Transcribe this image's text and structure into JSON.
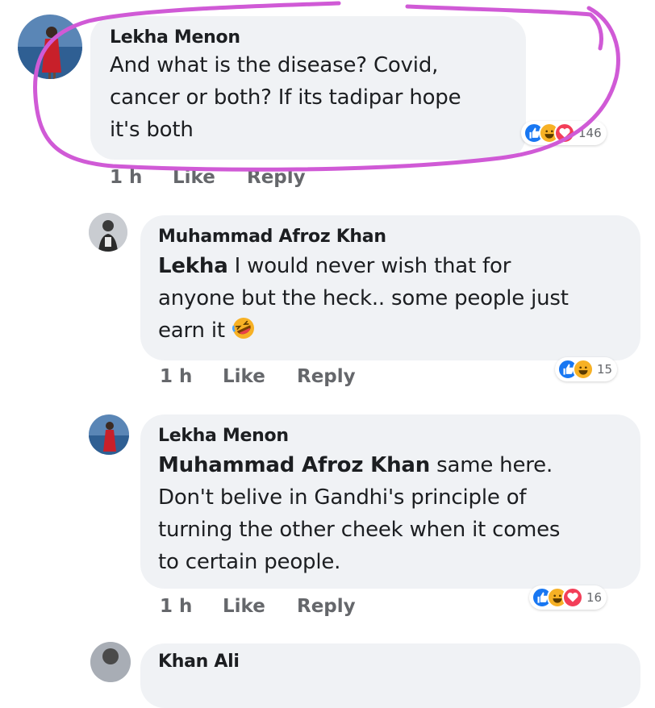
{
  "comments": [
    {
      "author": "Lekha Menon",
      "text": "And what is the disease? Covid, cancer or both? If its tadipar hope it's both",
      "text_lines": [
        "And what is the disease? Covid,",
        "cancer or both? If its tadipar hope",
        "it's both"
      ],
      "time": "1 h",
      "like_label": "Like",
      "reply_label": "Reply",
      "reaction_count": "146",
      "reactions": [
        "like-icon",
        "haha-icon",
        "love-icon"
      ]
    },
    {
      "author": "Muhammad Afroz Khan",
      "mention": "Lekha",
      "text_lines": [
        " I would never wish that for",
        "anyone but the heck.. some people just",
        "earn it "
      ],
      "emoji": "rolling-on-floor-laughing-icon",
      "time": "1 h",
      "like_label": "Like",
      "reply_label": "Reply",
      "reaction_count": "15",
      "reactions": [
        "like-icon",
        "haha-icon"
      ]
    },
    {
      "author": "Lekha Menon",
      "mention": "Muhammad Afroz Khan",
      "text_lines": [
        " same here.",
        "Don't belive in Gandhi's principle of",
        "turning the other cheek when it comes",
        "to certain people."
      ],
      "time": "1 h",
      "like_label": "Like",
      "reply_label": "Reply",
      "reaction_count": "16",
      "reactions": [
        "like-icon",
        "haha-icon",
        "love-icon"
      ]
    },
    {
      "author": "Khan Ali"
    }
  ],
  "colors": {
    "like": "#1877f2",
    "haha": "#f7b125",
    "love": "#f33e58",
    "highlight": "#d05ad6",
    "bubble": "#f0f2f5"
  }
}
